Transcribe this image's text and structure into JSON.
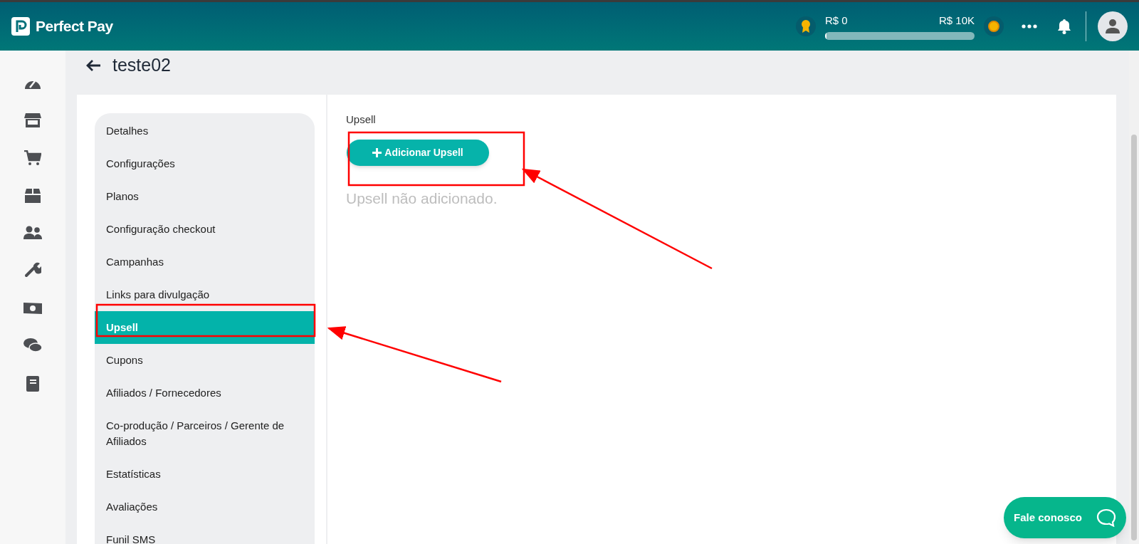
{
  "header": {
    "brand": "Perfect Pay",
    "progress": {
      "start_label": "R$ 0",
      "end_label": "R$ 10K",
      "level": 0.01
    }
  },
  "page": {
    "title": "teste02"
  },
  "menu": [
    {
      "label": "Detalhes",
      "selected": false
    },
    {
      "label": "Configurações",
      "selected": false
    },
    {
      "label": "Planos",
      "selected": false
    },
    {
      "label": "Configuração checkout",
      "selected": false
    },
    {
      "label": "Campanhas",
      "selected": false
    },
    {
      "label": "Links para divulgação",
      "selected": false
    },
    {
      "label": "Upsell",
      "selected": true
    },
    {
      "label": "Cupons",
      "selected": false
    },
    {
      "label": "Afiliados / Fornecedores",
      "selected": false
    },
    {
      "label": "Co-produção / Parceiros / Gerente de Afiliados",
      "selected": false
    },
    {
      "label": "Estatísticas",
      "selected": false
    },
    {
      "label": "Avaliações",
      "selected": false
    },
    {
      "label": "Funil SMS",
      "selected": false
    }
  ],
  "content": {
    "heading": "Upsell",
    "add_button": "Adicionar Upsell",
    "empty_message": "Upsell não adicionado."
  },
  "chat_button": "Fale conosco"
}
